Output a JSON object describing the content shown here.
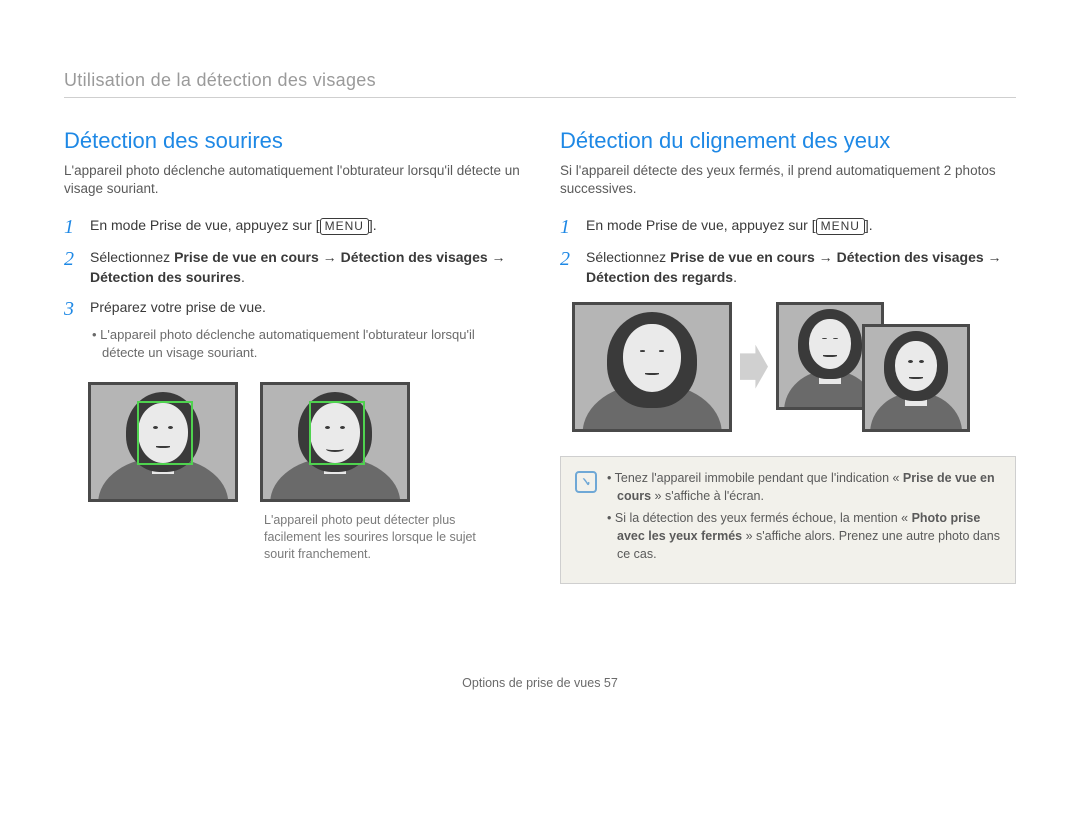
{
  "header": "Utilisation de la détection des visages",
  "menu_label": "MENU",
  "left": {
    "title": "Détection des sourires",
    "intro": "L'appareil photo déclenche automatiquement l'obturateur lorsqu'il détecte un visage souriant.",
    "step1": "En mode Prise de vue, appuyez sur ",
    "step2_a": "Sélectionnez ",
    "step2_b": "Prise de vue en cours",
    "step2_c": " → ",
    "step2_d": "Détection des visages",
    "step2_e": " → ",
    "step2_f": "Détection des sourires",
    "step2_g": ".",
    "step3": "Préparez votre prise de vue.",
    "sub": "L'appareil photo déclenche automatiquement l'obturateur lorsqu'il détecte un visage souriant.",
    "caption": "L'appareil photo peut détecter plus facilement les sourires lorsque le sujet sourit franchement."
  },
  "right": {
    "title": "Détection du clignement des yeux",
    "intro": "Si l'appareil détecte des yeux fermés, il prend automatiquement 2 photos successives.",
    "step1": "En mode Prise de vue, appuyez sur ",
    "step2_a": "Sélectionnez ",
    "step2_b": "Prise de vue en cours",
    "step2_c": " → ",
    "step2_d": "Détection des visages",
    "step2_e": " → ",
    "step2_f": "Détection des regards",
    "step2_g": ".",
    "note1_a": "Tenez l'appareil immobile pendant que l'indication « ",
    "note1_b": "Prise de vue en cours",
    "note1_c": " » s'affiche à l'écran.",
    "note2_a": "Si la détection des yeux fermés échoue, la mention « ",
    "note2_b": "Photo prise avec les yeux fermés",
    "note2_c": " » s'affiche alors. Prenez une autre photo dans ce cas."
  },
  "footer_label": "Options de prise de vues  ",
  "footer_page": "57"
}
